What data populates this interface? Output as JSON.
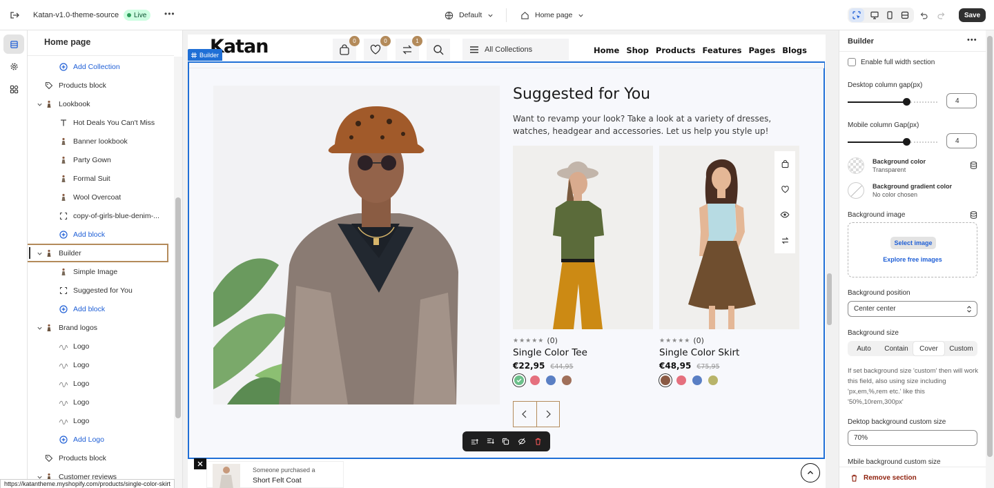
{
  "topbar": {
    "theme_name": "Katan-v1.0-theme-source",
    "status_badge": "Live",
    "more_label": "•••",
    "preset_label": "Default",
    "page_selector_label": "Home page",
    "save_label": "Save",
    "icons": [
      "exit-icon",
      "globe-icon",
      "home-icon",
      "inspector-icon",
      "desktop-icon",
      "mobile-icon",
      "fullwidth-icon",
      "undo-icon",
      "redo-icon"
    ]
  },
  "rail": {
    "items": [
      {
        "name": "sections",
        "icon": "layout-icon",
        "active": true
      },
      {
        "name": "theme-settings",
        "icon": "gear-icon",
        "active": false
      },
      {
        "name": "apps",
        "icon": "apps-icon",
        "active": false
      }
    ]
  },
  "left_panel": {
    "title": "Home page",
    "tree": [
      {
        "label": "Add Collection",
        "type": "add",
        "depth": 2
      },
      {
        "label": "Products block",
        "type": "tag",
        "depth": 1
      },
      {
        "label": "Lookbook",
        "type": "section",
        "depth": 1,
        "expanded": true
      },
      {
        "label": "Hot Deals You Can't Miss",
        "type": "text",
        "depth": 2
      },
      {
        "label": "Banner lookbook",
        "type": "figure",
        "depth": 2
      },
      {
        "label": "Party Gown",
        "type": "figure",
        "depth": 2
      },
      {
        "label": "Formal Suit",
        "type": "figure",
        "depth": 2
      },
      {
        "label": "Wool Overcoat",
        "type": "figure",
        "depth": 2
      },
      {
        "label": "copy-of-girls-blue-denim-...",
        "type": "frame",
        "depth": 2
      },
      {
        "label": "Add block",
        "type": "add",
        "depth": 2
      },
      {
        "label": "Builder",
        "type": "section",
        "depth": 1,
        "expanded": true,
        "selected": true
      },
      {
        "label": "Simple Image",
        "type": "figure",
        "depth": 2
      },
      {
        "label": "Suggested for You",
        "type": "frame",
        "depth": 2
      },
      {
        "label": "Add block",
        "type": "add",
        "depth": 2
      },
      {
        "label": "Brand logos",
        "type": "section",
        "depth": 1,
        "expanded": true
      },
      {
        "label": "Logo",
        "type": "logo",
        "depth": 2
      },
      {
        "label": "Logo",
        "type": "logo",
        "depth": 2
      },
      {
        "label": "Logo",
        "type": "logo",
        "depth": 2
      },
      {
        "label": "Logo",
        "type": "logo",
        "depth": 2
      },
      {
        "label": "Logo",
        "type": "logo",
        "depth": 2
      },
      {
        "label": "Add Logo",
        "type": "add",
        "depth": 2
      },
      {
        "label": "Products block",
        "type": "tag",
        "depth": 1
      },
      {
        "label": "Customer reviews",
        "type": "section",
        "depth": 1,
        "expanded": true
      }
    ]
  },
  "status_url": "https://katantheme.myshopify.com/products/single-color-skirt",
  "storefront": {
    "logo_text": "Katan",
    "cart_count": "0",
    "wishlist_count": "0",
    "compare_count": "1",
    "collections_label": "All Collections",
    "nav": [
      "Home",
      "Shop",
      "Products",
      "Features",
      "Pages",
      "Blogs"
    ],
    "section_tag": "Builder",
    "heading": "Suggested for You",
    "subheading": "Want to revamp your look? Take a look at a variety of dresses, watches, headgear and accessories. Let us help you style up!",
    "products": [
      {
        "title": "Single Color Tee",
        "rating_text": "(0)",
        "stars": "★★★★★",
        "price": "€22,95",
        "compare_price": "€44,95",
        "swatches": [
          "#6cc08b",
          "#e5707e",
          "#5a7fc4",
          "#a0705a"
        ],
        "selected_swatch": 0
      },
      {
        "title": "Single Color Skirt",
        "rating_text": "(0)",
        "stars": "★★★★★",
        "price": "€48,95",
        "compare_price": "€75,95",
        "swatches": [
          "#8a5a44",
          "#e5707e",
          "#5a7fc4",
          "#b8b46a"
        ],
        "selected_swatch": 0
      }
    ],
    "toast": {
      "line1": "Someone purchased a",
      "line2": "Short Felt Coat"
    },
    "quick_actions": [
      "bag-icon",
      "heart-icon",
      "eye-icon",
      "compare-icon"
    ],
    "toolbar_icons": [
      "move-up-icon",
      "move-down-icon",
      "duplicate-icon",
      "hide-icon",
      "delete-icon"
    ]
  },
  "right_panel": {
    "title": "Builder",
    "more_label": "•••",
    "full_width_label": "Enable full width section",
    "full_width_checked": false,
    "desktop_gap_label": "Desktop column gap(px)",
    "desktop_gap_value": "4",
    "desktop_gap_level": 0.65,
    "mobile_gap_label": "Mobile column Gap(px)",
    "mobile_gap_value": "4",
    "mobile_gap_level": 0.65,
    "bg_color_label": "Background color",
    "bg_color_value": "Transparent",
    "bg_gradient_label": "Background gradient color",
    "bg_gradient_value": "No color chosen",
    "bg_image_label": "Background image",
    "select_image_label": "Select image",
    "explore_label": "Explore free images",
    "bg_position_label": "Background position",
    "bg_position_value": "Center center",
    "bg_size_label": "Background size",
    "bg_size_options": [
      "Auto",
      "Contain",
      "Cover",
      "Custom"
    ],
    "bg_size_selected": "Cover",
    "help_text": "If set background size 'custom' then will work this field, also using size including 'px,em,%,rem etc.' like this '50%,10rem,300px'",
    "desktop_custom_label": "Dektop background custom size",
    "desktop_custom_value": "70%",
    "mobile_custom_label": "Mbile background custom size",
    "remove_label": "Remove section",
    "accent_color": "#8e1f0b"
  },
  "colors": {
    "brand_tan": "#b38a5a",
    "selection_blue": "#1f6fd6",
    "live_green": "#2e9e5b",
    "link_blue": "#1f5fd6"
  }
}
